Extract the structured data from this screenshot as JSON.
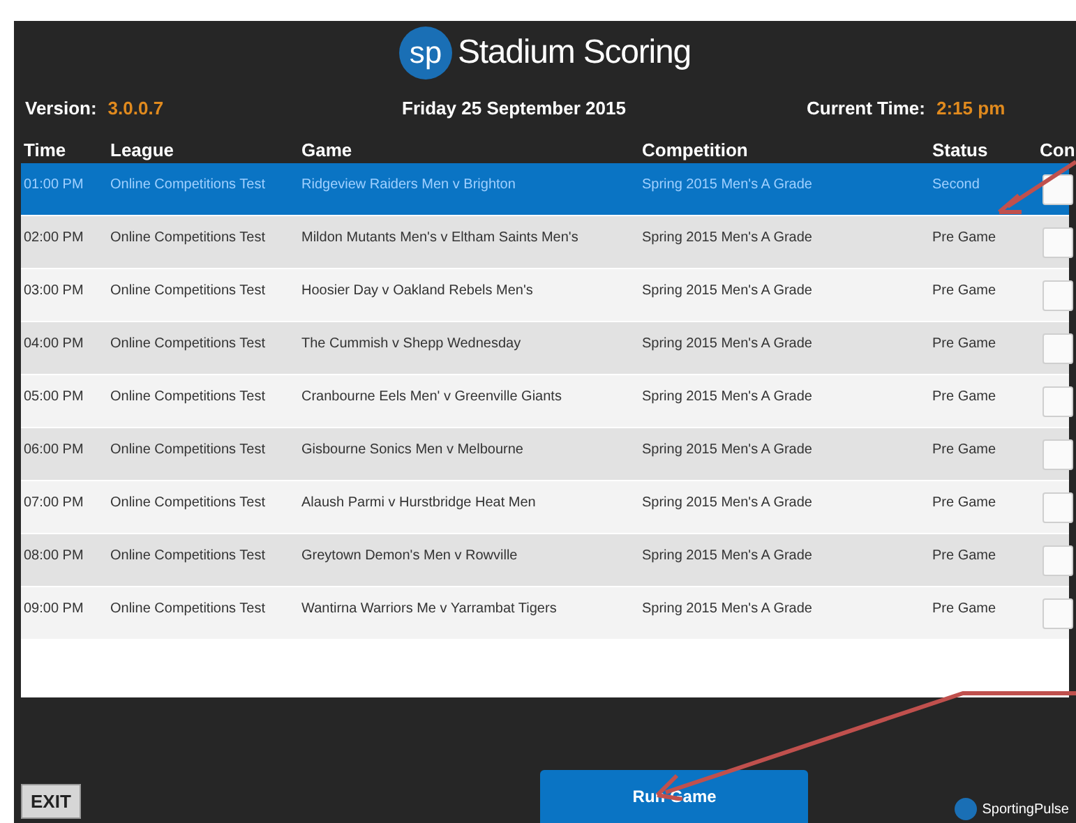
{
  "header": {
    "logo_mark": "sp",
    "title": "Stadium Scoring",
    "version_label": "Version:",
    "version": "3.0.0.7",
    "date": "Friday 25 September  2015",
    "time_label": "Current Time:",
    "time": "2:15 pm"
  },
  "table": {
    "columns": [
      "Time",
      "League",
      "Game",
      "Competition",
      "Status",
      "Con"
    ],
    "rows": [
      {
        "time": "01:00 PM",
        "league": "Online Competitions Test",
        "game": "Ridgeview Raiders Men v Brighton",
        "competition": "Spring 2015 Men's A Grade",
        "status": "Second",
        "selected": true,
        "checked": false
      },
      {
        "time": "02:00 PM",
        "league": "Online Competitions Test",
        "game": "Mildon Mutants Men's v Eltham Saints Men's",
        "competition": "Spring 2015 Men's A Grade",
        "status": "Pre Game",
        "selected": false,
        "checked": false
      },
      {
        "time": "03:00 PM",
        "league": "Online Competitions Test",
        "game": "Hoosier Day v Oakland Rebels Men's",
        "competition": "Spring 2015 Men's A Grade",
        "status": "Pre Game",
        "selected": false,
        "checked": false
      },
      {
        "time": "04:00 PM",
        "league": "Online Competitions Test",
        "game": "The Cummish v Shepp Wednesday",
        "competition": "Spring 2015 Men's A Grade",
        "status": "Pre Game",
        "selected": false,
        "checked": false
      },
      {
        "time": "05:00 PM",
        "league": "Online Competitions Test",
        "game": "Cranbourne Eels Men' v Greenville Giants",
        "competition": "Spring 2015 Men's A Grade",
        "status": "Pre Game",
        "selected": false,
        "checked": false
      },
      {
        "time": "06:00 PM",
        "league": "Online Competitions Test",
        "game": "Gisbourne Sonics Men v Melbourne",
        "competition": "Spring 2015 Men's A Grade",
        "status": "Pre Game",
        "selected": false,
        "checked": false
      },
      {
        "time": "07:00 PM",
        "league": "Online Competitions Test",
        "game": "Alaush Parmi v Hurstbridge Heat Men",
        "competition": "Spring 2015 Men's A Grade",
        "status": "Pre Game",
        "selected": false,
        "checked": false
      },
      {
        "time": "08:00 PM",
        "league": "Online Competitions Test",
        "game": "Greytown Demon's Men v Rowville",
        "competition": "Spring 2015 Men's A Grade",
        "status": "Pre Game",
        "selected": false,
        "checked": false
      },
      {
        "time": "09:00 PM",
        "league": "Online Competitions Test",
        "game": "Wantirna Warriors Me v Yarrambat Tigers",
        "competition": "Spring 2015 Men's A Grade",
        "status": "Pre Game",
        "selected": false,
        "checked": false
      }
    ]
  },
  "footer": {
    "exit": "EXIT",
    "run": "Run Game",
    "brand": "SportingPulse"
  }
}
